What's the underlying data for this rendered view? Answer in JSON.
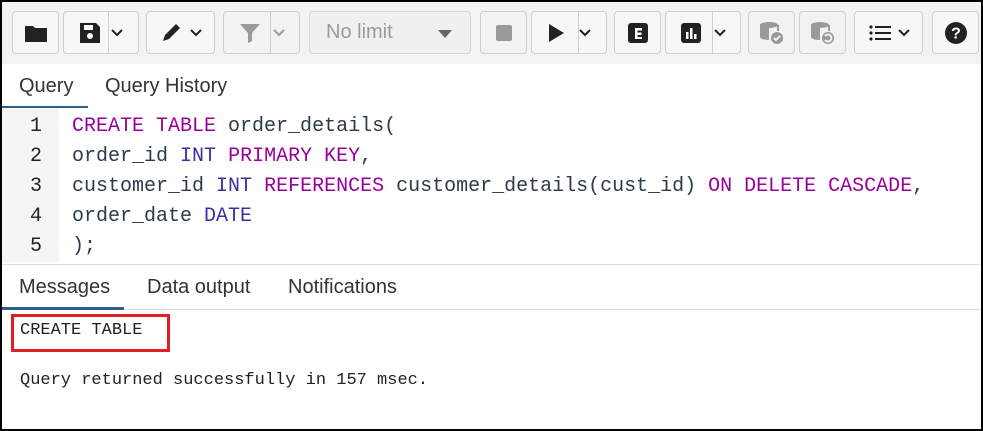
{
  "toolbar": {
    "limit_select": {
      "value": "No limit"
    },
    "buttons": [
      {
        "name": "open-file",
        "icon": "folder-icon"
      },
      {
        "name": "save-file",
        "icon": "save-icon"
      },
      {
        "name": "edit",
        "icon": "pencil-icon"
      },
      {
        "name": "filter",
        "icon": "filter-icon"
      },
      {
        "name": "stop",
        "icon": "stop-icon"
      },
      {
        "name": "execute",
        "icon": "play-icon"
      },
      {
        "name": "explain",
        "icon": "explain-icon",
        "label": "E"
      },
      {
        "name": "explain-analyze",
        "icon": "chart-icon"
      },
      {
        "name": "commit",
        "icon": "database-commit-icon"
      },
      {
        "name": "rollback",
        "icon": "database-rollback-icon"
      },
      {
        "name": "macros",
        "icon": "list-icon"
      },
      {
        "name": "help",
        "icon": "help-icon",
        "label": "?"
      }
    ]
  },
  "editor_tabs": [
    {
      "label": "Query",
      "active": true
    },
    {
      "label": "Query History",
      "active": false
    }
  ],
  "editor": {
    "lines": [
      {
        "no": "1",
        "tokens": [
          {
            "t": "CREATE",
            "c": "kw"
          },
          {
            "t": " ",
            "c": "tx"
          },
          {
            "t": "TABLE",
            "c": "kw"
          },
          {
            "t": " order_details(",
            "c": "tx"
          }
        ]
      },
      {
        "no": "2",
        "tokens": [
          {
            "t": "order_id ",
            "c": "tx"
          },
          {
            "t": "INT",
            "c": "ty"
          },
          {
            "t": " ",
            "c": "tx"
          },
          {
            "t": "PRIMARY KEY",
            "c": "kw"
          },
          {
            "t": ",",
            "c": "tx"
          }
        ]
      },
      {
        "no": "3",
        "tokens": [
          {
            "t": "customer_id ",
            "c": "tx"
          },
          {
            "t": "INT",
            "c": "ty"
          },
          {
            "t": " ",
            "c": "tx"
          },
          {
            "t": "REFERENCES",
            "c": "kw"
          },
          {
            "t": " customer_details(cust_id) ",
            "c": "tx"
          },
          {
            "t": "ON DELETE CASCADE",
            "c": "kw"
          },
          {
            "t": ",",
            "c": "tx"
          }
        ]
      },
      {
        "no": "4",
        "tokens": [
          {
            "t": "order_date ",
            "c": "tx"
          },
          {
            "t": "DATE",
            "c": "ty"
          }
        ]
      },
      {
        "no": "5",
        "tokens": [
          {
            "t": ");",
            "c": "tx"
          }
        ]
      }
    ]
  },
  "output_tabs": [
    {
      "label": "Messages",
      "active": true
    },
    {
      "label": "Data output",
      "active": false
    },
    {
      "label": "Notifications",
      "active": false
    }
  ],
  "messages": {
    "result": "CREATE TABLE",
    "status": "Query returned successfully in 157 msec."
  },
  "colors": {
    "keyword": "#990099",
    "type": "#3b2fa6",
    "active_tab": "#2c5f8a",
    "highlight_box": "#e31e24"
  }
}
